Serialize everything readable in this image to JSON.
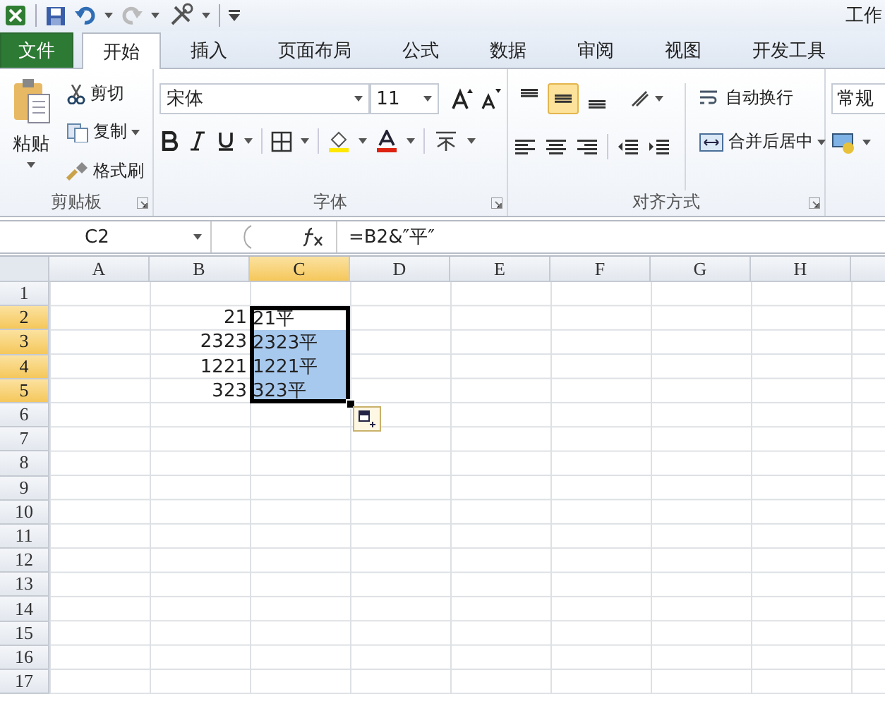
{
  "window": {
    "title": "工作"
  },
  "tabs": [
    {
      "label": "文件",
      "kind": "file",
      "selected": false
    },
    {
      "label": "开始",
      "kind": "tab",
      "selected": true
    },
    {
      "label": "插入",
      "kind": "tab",
      "selected": false
    },
    {
      "label": "页面布局",
      "kind": "tab",
      "selected": false
    },
    {
      "label": "公式",
      "kind": "tab",
      "selected": false
    },
    {
      "label": "数据",
      "kind": "tab",
      "selected": false
    },
    {
      "label": "审阅",
      "kind": "tab",
      "selected": false
    },
    {
      "label": "视图",
      "kind": "tab",
      "selected": false
    },
    {
      "label": "开发工具",
      "kind": "tab",
      "selected": false
    }
  ],
  "clipboard": {
    "paste": "粘贴",
    "cut": "剪切",
    "copy": "复制",
    "format_painter": "格式刷",
    "label": "剪贴板"
  },
  "font": {
    "name": "宋体",
    "size": "11",
    "label": "字体"
  },
  "alignment": {
    "vertical": [
      {
        "selected": false
      },
      {
        "selected": true
      },
      {
        "selected": false
      }
    ],
    "wrap_text": "自动换行",
    "merge": "合并后居中",
    "label": "对齐方式"
  },
  "number": {
    "format": "常规"
  },
  "formula_bar": {
    "name_box": "C2",
    "formula": "=B2&″平″"
  },
  "sheet": {
    "columns": [
      {
        "label": "A",
        "selected": false
      },
      {
        "label": "B",
        "selected": false
      },
      {
        "label": "C",
        "selected": true
      },
      {
        "label": "D",
        "selected": false
      },
      {
        "label": "E",
        "selected": false
      },
      {
        "label": "F",
        "selected": false
      },
      {
        "label": "G",
        "selected": false
      },
      {
        "label": "H",
        "selected": false
      }
    ],
    "rows": [
      {
        "label": "1",
        "selected": false
      },
      {
        "label": "2",
        "selected": true,
        "b_value": "21",
        "c_value": "21平",
        "c_selected": true,
        "c_active": true
      },
      {
        "label": "3",
        "selected": true,
        "b_value": "2323",
        "c_value": "2323平",
        "c_selected": true,
        "c_active": false
      },
      {
        "label": "4",
        "selected": true,
        "b_value": "1221",
        "c_value": "1221平",
        "c_selected": true,
        "c_active": false
      },
      {
        "label": "5",
        "selected": true,
        "b_value": "323",
        "c_value": "323平",
        "c_selected": true,
        "c_active": false
      },
      {
        "label": "6",
        "selected": false
      },
      {
        "label": "7",
        "selected": false
      },
      {
        "label": "8",
        "selected": false
      },
      {
        "label": "9",
        "selected": false
      },
      {
        "label": "10",
        "selected": false
      },
      {
        "label": "11",
        "selected": false
      },
      {
        "label": "12",
        "selected": false
      },
      {
        "label": "13",
        "selected": false
      },
      {
        "label": "14",
        "selected": false
      },
      {
        "label": "15",
        "selected": false
      },
      {
        "label": "16",
        "selected": false
      },
      {
        "label": "17",
        "selected": false
      }
    ]
  }
}
